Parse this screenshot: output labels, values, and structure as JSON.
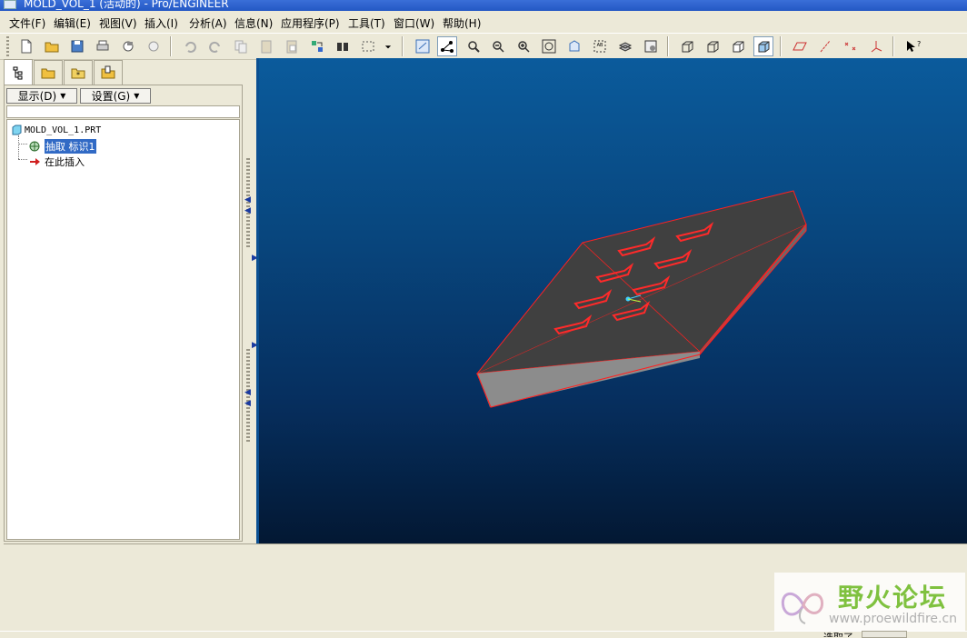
{
  "window": {
    "title": "MOLD_VOL_1 (活动的) - Pro/ENGINEER"
  },
  "menu": [
    "文件(F)",
    "编辑(E)",
    "视图(V)",
    "插入(I)",
    "分析(A)",
    "信息(N)",
    "应用程序(P)",
    "工具(T)",
    "窗口(W)",
    "帮助(H)"
  ],
  "toolbar": {
    "icons": [
      "new-file-icon",
      "open-folder-icon",
      "save-icon",
      "print-icon",
      "send-mail-icon",
      "mail-recipient-icon",
      "undo-icon",
      "redo-icon",
      "copy-icon",
      "paste-icon",
      "paste-special-icon",
      "regenerate-icon",
      "find-icon",
      "select-box-icon",
      "dropdown-arrow-icon",
      "spin-center-icon",
      "orient-mode-icon",
      "zoom-in-icon",
      "zoom-out-icon",
      "refit-icon",
      "reorient-icon",
      "saved-views-icon",
      "layers-icon",
      "view-manager-icon",
      "wireframe-icon",
      "hidden-line-icon",
      "no-hidden-icon",
      "shading-icon",
      "datum-plane-display-icon",
      "datum-axis-display-icon",
      "datum-point-display-icon",
      "coord-sys-display-icon",
      "whats-this-icon"
    ],
    "active": [
      "orient-mode-icon",
      "shading-icon"
    ]
  },
  "left_panel": {
    "tabs": [
      "model-tree-tab",
      "folder-browser-tab",
      "favorites-tab",
      "connections-tab"
    ],
    "show_button": "显示(D)",
    "settings_button": "设置(G)",
    "tree": {
      "root": "MOLD_VOL_1.PRT",
      "children": [
        {
          "label": "抽取 标识1",
          "selected": true,
          "icon": "extract-feature-icon"
        },
        {
          "label": "在此插入",
          "selected": false,
          "icon": "insert-here-arrow-icon"
        }
      ]
    }
  },
  "status": {
    "selection_filter_label": "选取了"
  },
  "watermark": {
    "title": "野火论坛",
    "url": "www.proewildfire.cn"
  },
  "colors": {
    "viewport_top": "#0b5b9c",
    "viewport_bottom": "#031833",
    "model_top": "#404040",
    "model_side": "#8c8c8c",
    "edge_highlight": "#ff2020",
    "watermark_green": "#7fc13f"
  }
}
